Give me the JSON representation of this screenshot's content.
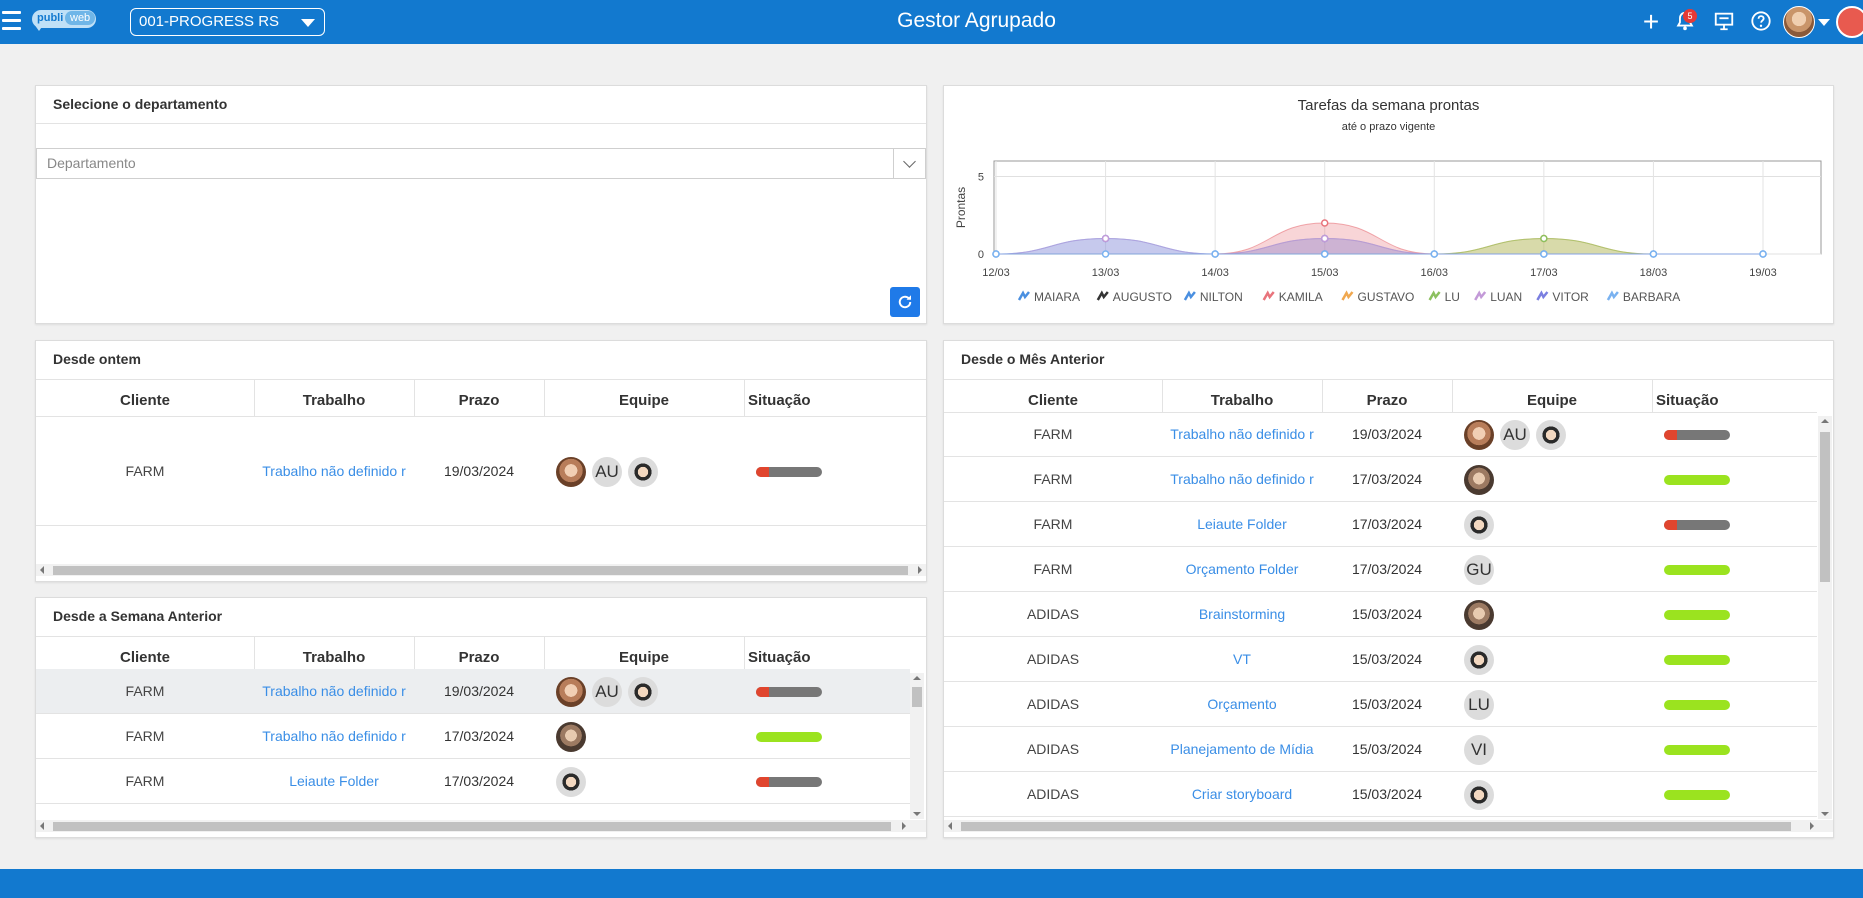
{
  "header": {
    "app_title": "Gestor Agrupado",
    "company_select": "001-PROGRESS RS",
    "logo_left": "publi",
    "logo_right": "web",
    "notifications_count": "5",
    "icons": [
      "menu-icon",
      "plus-icon",
      "bell-icon",
      "presentation-icon",
      "help-icon",
      "user-avatar",
      "logout-icon"
    ]
  },
  "departamento": {
    "title": "Selecione o departamento",
    "placeholder": "Departamento"
  },
  "columns": {
    "cliente": "Cliente",
    "trabalho": "Trabalho",
    "prazo": "Prazo",
    "equipe": "Equipe",
    "situacao": "Situação"
  },
  "desde_ontem": {
    "title": "Desde ontem",
    "rows": [
      {
        "cliente": "FARM",
        "trabalho": "Trabalho não definido r",
        "prazo": "19/03/2024",
        "equipe": [
          "photo",
          "AU",
          "photo"
        ],
        "progress": 0.2,
        "done": false
      }
    ]
  },
  "desde_semana": {
    "title": "Desde a Semana Anterior",
    "rows": [
      {
        "cliente": "FARM",
        "trabalho": "Trabalho não definido r",
        "prazo": "19/03/2024",
        "equipe": [
          "photo",
          "AU",
          "photo"
        ],
        "progress": 0.2,
        "done": false
      },
      {
        "cliente": "FARM",
        "trabalho": "Trabalho não definido r",
        "prazo": "17/03/2024",
        "equipe": [
          "photo"
        ],
        "progress": 1,
        "done": true
      },
      {
        "cliente": "FARM",
        "trabalho": "Leiaute Folder",
        "prazo": "17/03/2024",
        "equipe": [
          "photo"
        ],
        "progress": 0.2,
        "done": false
      }
    ]
  },
  "desde_mes": {
    "title": "Desde o Mês Anterior",
    "rows": [
      {
        "cliente": "FARM",
        "trabalho": "Trabalho não definido r",
        "prazo": "19/03/2024",
        "equipe": [
          "photo",
          "AU",
          "photo"
        ],
        "progress": 0.2,
        "done": false
      },
      {
        "cliente": "FARM",
        "trabalho": "Trabalho não definido r",
        "prazo": "17/03/2024",
        "equipe": [
          "photo"
        ],
        "progress": 1,
        "done": true
      },
      {
        "cliente": "FARM",
        "trabalho": "Leiaute Folder",
        "prazo": "17/03/2024",
        "equipe": [
          "photo"
        ],
        "progress": 0.2,
        "done": false
      },
      {
        "cliente": "FARM",
        "trabalho": "Orçamento Folder",
        "prazo": "17/03/2024",
        "equipe": [
          "GU"
        ],
        "progress": 1,
        "done": true
      },
      {
        "cliente": "ADIDAS",
        "trabalho": "Brainstorming",
        "prazo": "15/03/2024",
        "equipe": [
          "photo"
        ],
        "progress": 1,
        "done": true
      },
      {
        "cliente": "ADIDAS",
        "trabalho": "VT",
        "prazo": "15/03/2024",
        "equipe": [
          "photo"
        ],
        "progress": 1,
        "done": true
      },
      {
        "cliente": "ADIDAS",
        "trabalho": "Orçamento",
        "prazo": "15/03/2024",
        "equipe": [
          "LU"
        ],
        "progress": 1,
        "done": true
      },
      {
        "cliente": "ADIDAS",
        "trabalho": "Planejamento de Mídia",
        "prazo": "15/03/2024",
        "equipe": [
          "VI"
        ],
        "progress": 1,
        "done": true
      },
      {
        "cliente": "ADIDAS",
        "trabalho": "Criar storyboard",
        "prazo": "15/03/2024",
        "equipe": [
          "photo"
        ],
        "progress": 1,
        "done": true
      }
    ]
  },
  "chart_data": {
    "type": "area",
    "title": "Tarefas da semana prontas",
    "subtitle": "até o prazo vigente",
    "ylabel": "Prontas",
    "xlabel": "",
    "categories": [
      "12/03",
      "13/03",
      "14/03",
      "15/03",
      "16/03",
      "17/03",
      "18/03",
      "19/03"
    ],
    "yticks": [
      0,
      5
    ],
    "ylim": [
      0,
      6
    ],
    "grid": true,
    "legend_position": "bottom",
    "series": [
      {
        "name": "MAIARA",
        "color": "#4a8fe0",
        "values": [
          0,
          1,
          0,
          0,
          0,
          0,
          0,
          0
        ]
      },
      {
        "name": "AUGUSTO",
        "color": "#333333",
        "values": [
          0,
          0,
          0,
          0,
          0,
          0,
          0,
          0
        ]
      },
      {
        "name": "NILTON",
        "color": "#4a8fe0",
        "values": [
          0,
          0,
          0,
          1,
          0,
          0,
          0,
          0
        ]
      },
      {
        "name": "KAMILA",
        "color": "#e8747c",
        "values": [
          0,
          0,
          0,
          2,
          0,
          0,
          0,
          0
        ]
      },
      {
        "name": "GUSTAVO",
        "color": "#f0a850",
        "values": [
          0,
          0,
          0,
          0,
          0,
          1,
          0,
          0
        ]
      },
      {
        "name": "LU",
        "color": "#8cc060",
        "values": [
          0,
          0,
          0,
          0,
          0,
          1,
          0,
          0
        ]
      },
      {
        "name": "LUAN",
        "color": "#c39ad8",
        "values": [
          0,
          1,
          0,
          1,
          0,
          0,
          0,
          0
        ]
      },
      {
        "name": "VITOR",
        "color": "#7b7fe0",
        "values": [
          0,
          0,
          0,
          0,
          0,
          0,
          0,
          0
        ]
      },
      {
        "name": "BARBARA",
        "color": "#7ab2f0",
        "values": [
          0,
          0,
          0,
          0,
          0,
          0,
          0,
          0
        ]
      }
    ]
  }
}
